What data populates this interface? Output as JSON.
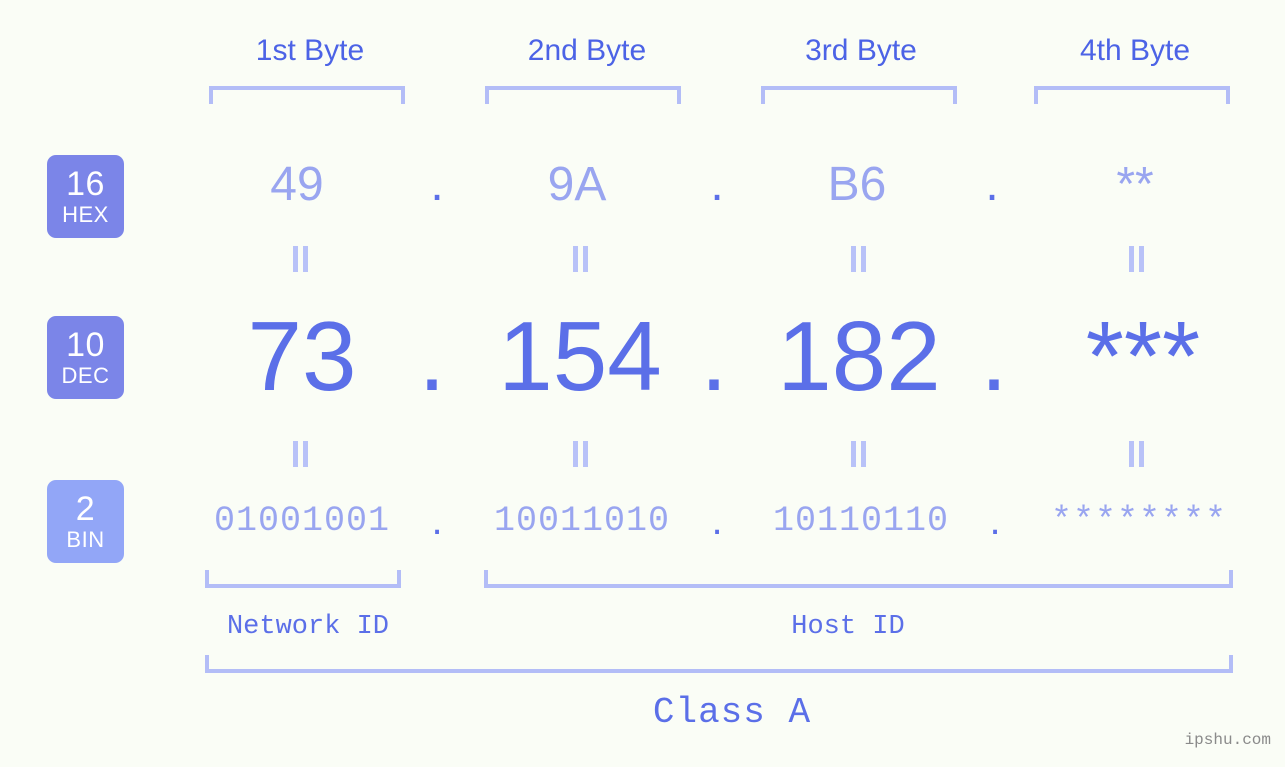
{
  "colors": {
    "background": "#fafdf6",
    "accent_dark": "#5b6fe8",
    "accent_light": "#99a5f0",
    "bracket": "#b3bdf7",
    "badge_solid": "#7b85e8",
    "badge_light": "#92a6f7",
    "header_text": "#4c63e6",
    "watermark": "#8a8a8a"
  },
  "header": {
    "bytes": [
      {
        "label": "1st Byte"
      },
      {
        "label": "2nd Byte"
      },
      {
        "label": "3rd Byte"
      },
      {
        "label": "4th Byte"
      }
    ]
  },
  "bases": [
    {
      "num": "16",
      "name": "HEX"
    },
    {
      "num": "10",
      "name": "DEC"
    },
    {
      "num": "2",
      "name": "BIN"
    }
  ],
  "rows": {
    "hex": {
      "base_num": "16",
      "base_name": "HEX",
      "values": [
        "49",
        "9A",
        "B6",
        "**"
      ],
      "separator": "."
    },
    "dec": {
      "base_num": "10",
      "base_name": "DEC",
      "values": [
        "73",
        "154",
        "182",
        "***"
      ],
      "separator": "."
    },
    "bin": {
      "base_num": "2",
      "base_name": "BIN",
      "values": [
        "01001001",
        "10011010",
        "10110110",
        "********"
      ],
      "separator": "."
    }
  },
  "connectors": {
    "symbol": "=",
    "count_top": 4,
    "count_bottom": 4
  },
  "footer": {
    "network_id_label": "Network ID",
    "host_id_label": "Host ID",
    "class_label": "Class A"
  },
  "watermark": "ipshu.com"
}
